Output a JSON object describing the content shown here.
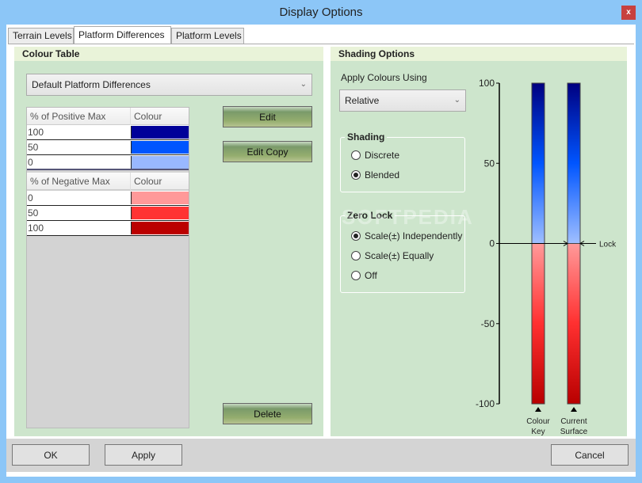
{
  "window": {
    "title": "Display Options",
    "close_label": "x"
  },
  "tabs": [
    {
      "label": "Terrain Levels",
      "active": false
    },
    {
      "label": "Platform Differences",
      "active": true
    },
    {
      "label": "Platform Levels",
      "active": false
    }
  ],
  "colour_table": {
    "header": "Colour Table",
    "preset": "Default Platform Differences",
    "positive": {
      "col1": "% of Positive Max",
      "col2": "Colour",
      "rows": [
        {
          "value": "100",
          "colour": "#000099"
        },
        {
          "value": "50",
          "colour": "#0055ff"
        },
        {
          "value": "0",
          "colour": "#99b8ff"
        }
      ]
    },
    "negative": {
      "col1": "% of Negative Max",
      "col2": "Colour",
      "rows": [
        {
          "value": "0",
          "colour": "#ff9999"
        },
        {
          "value": "50",
          "colour": "#ff3333"
        },
        {
          "value": "100",
          "colour": "#bb0000"
        }
      ]
    },
    "buttons": {
      "edit": "Edit",
      "edit_copy": "Edit Copy",
      "delete": "Delete"
    }
  },
  "shading_options": {
    "header": "Shading Options",
    "apply_label": "Apply Colours Using",
    "apply_value": "Relative",
    "shading": {
      "title": "Shading",
      "options": [
        {
          "label": "Discrete",
          "selected": false
        },
        {
          "label": "Blended",
          "selected": true
        }
      ]
    },
    "zero_lock": {
      "title": "Zero Lock",
      "options": [
        {
          "label": "Scale(±) Independently",
          "selected": true
        },
        {
          "label": "Scale(±) Equally",
          "selected": false
        },
        {
          "label": "Off",
          "selected": false
        }
      ]
    }
  },
  "scale": {
    "ticks": [
      "100",
      "50",
      "0",
      "-50",
      "-100"
    ],
    "tick_values": [
      100,
      50,
      0,
      -50,
      -100
    ],
    "range": [
      -100,
      100
    ],
    "lock_label": "Lock",
    "bars": [
      {
        "label_line1": "Colour",
        "label_line2": "Key"
      },
      {
        "label_line1": "Current",
        "label_line2": "Surface"
      }
    ]
  },
  "footer": {
    "ok": "OK",
    "apply": "Apply",
    "cancel": "Cancel"
  },
  "watermark": "SOFTPEDIA"
}
